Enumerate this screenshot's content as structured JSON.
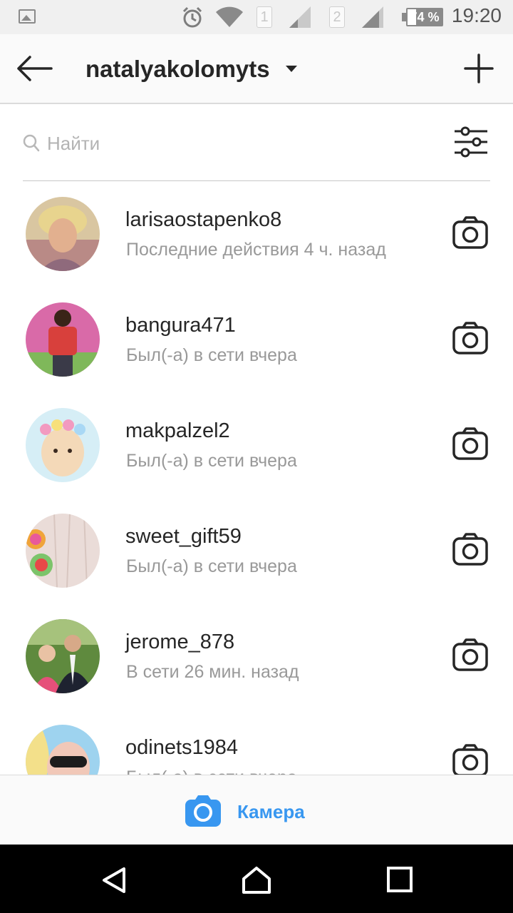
{
  "status_bar": {
    "time": "19:20",
    "battery_percent_label": "74 %",
    "battery_level": 0.74,
    "sim_slots": [
      "1",
      "2"
    ],
    "icons": [
      "image-notification-icon",
      "alarm-icon",
      "wifi-icon",
      "signal-icon",
      "battery-icon"
    ]
  },
  "header": {
    "title": "natalyakolomyts",
    "icons": [
      "back-arrow-icon",
      "caret-down-icon",
      "plus-icon"
    ]
  },
  "search": {
    "placeholder": "Найти",
    "value": "",
    "icons": [
      "search-icon",
      "filter-sliders-icon"
    ]
  },
  "conversations": [
    {
      "username": "larisaostapenko8",
      "status": "Последние действия 4 ч. назад"
    },
    {
      "username": "bangura471",
      "status": "Был(-а) в сети вчера"
    },
    {
      "username": "makpalzel2",
      "status": "Был(-а) в сети вчера"
    },
    {
      "username": "sweet_gift59",
      "status": "Был(-а) в сети вчера"
    },
    {
      "username": "jerome_878",
      "status": "В сети 26 мин. назад"
    },
    {
      "username": "odinets1984",
      "status": "Был(-а) в сети вчера"
    }
  ],
  "bottom_bar": {
    "label": "Камера",
    "icon": "camera-filled-icon"
  },
  "nav_bar": {
    "icons": [
      "back-triangle-icon",
      "home-icon",
      "recents-square-icon"
    ]
  },
  "colors": {
    "accent": "#3897f0",
    "text": "#262626",
    "secondary_text": "#999999",
    "nav_background": "#000000"
  }
}
